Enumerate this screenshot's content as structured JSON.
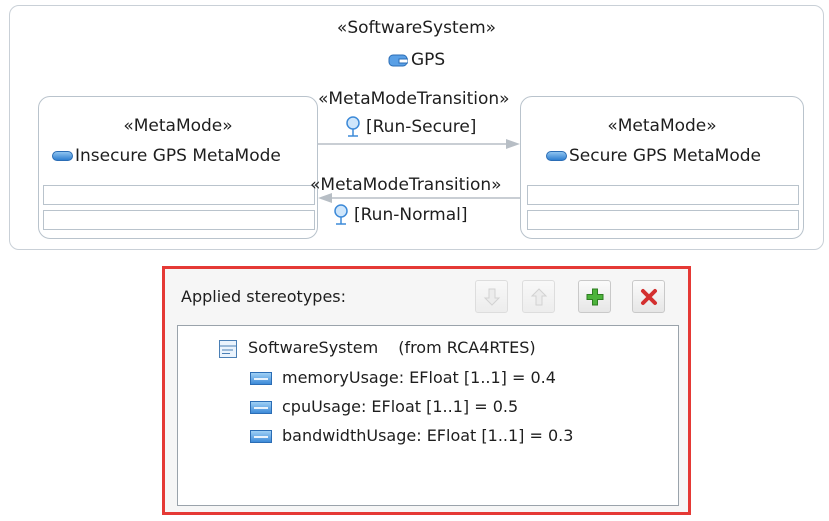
{
  "diagram": {
    "system_stereotype": "«SoftwareSystem»",
    "system_name": "GPS",
    "left_mode": {
      "stereotype": "«MetaMode»",
      "name": "Insecure GPS MetaMode"
    },
    "right_mode": {
      "stereotype": "«MetaMode»",
      "name": "Secure GPS MetaMode"
    },
    "transition_top": {
      "stereotype": "«MetaModeTransition»",
      "guard": "[Run-Secure]"
    },
    "transition_bottom": {
      "stereotype": "«MetaModeTransition»",
      "guard": "[Run-Normal]"
    }
  },
  "stereotype_panel": {
    "label": "Applied stereotypes:",
    "buttons": [
      "move-down",
      "move-up",
      "add",
      "remove"
    ],
    "root": {
      "name": "SoftwareSystem",
      "source": "(from RCA4RTES)"
    },
    "properties": [
      "memoryUsage: EFloat [1..1] = 0.4",
      "cpuUsage: EFloat [1..1] = 0.5",
      "bandwidthUsage: EFloat [1..1] = 0.3"
    ],
    "colors": {
      "highlight_border": "#e53935",
      "add": "#3a9e2f",
      "remove": "#d32f2f"
    }
  }
}
